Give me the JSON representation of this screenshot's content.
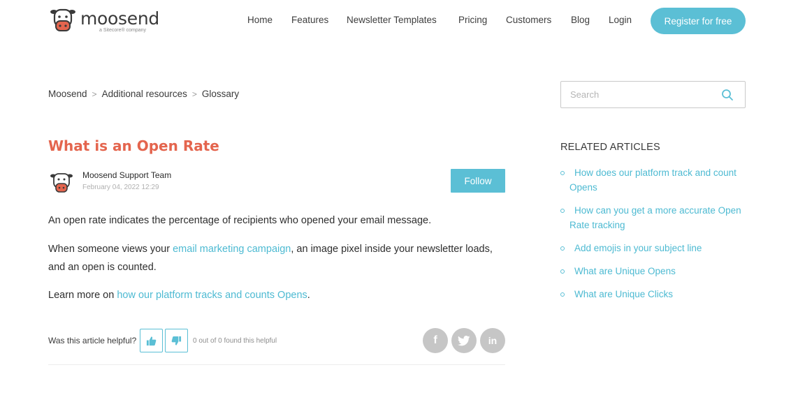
{
  "header": {
    "logo_name": "moosend",
    "logo_sub": "a Sitecore® company",
    "nav": [
      "Home",
      "Features",
      "Newsletter Templates",
      "Pricing",
      "Customers",
      "Blog",
      "Login"
    ],
    "register_label": "Register for free"
  },
  "breadcrumb": [
    "Moosend",
    "Additional resources",
    "Glossary"
  ],
  "search": {
    "placeholder": "Search"
  },
  "article": {
    "title": "What is an Open Rate",
    "author": "Moosend Support Team",
    "date": "February 04, 2022 12:29",
    "follow_label": "Follow",
    "p1": "An open rate indicates the percentage of recipients who opened your email message.",
    "p2_before": "When someone views your ",
    "p2_link": "email marketing campaign",
    "p2_after": ", an image pixel inside your newsletter loads, and an open is counted.",
    "p3_before": "Learn more on ",
    "p3_link": "how our platform tracks and counts Opens",
    "p3_after": "."
  },
  "feedback": {
    "question": "Was this article helpful?",
    "count_text": "0 out of 0 found this helpful"
  },
  "share": {
    "facebook": "f",
    "linkedin": "in"
  },
  "related": {
    "title": "RELATED ARTICLES",
    "items": [
      "How does our platform track and count Opens",
      "How can you get a more accurate Open Rate tracking",
      "Add emojis in your subject line",
      "What are Unique Opens",
      "What are Unique Clicks"
    ]
  },
  "colors": {
    "accent": "#5bbfd5",
    "link": "#4dbad2",
    "title": "#e4654e",
    "share_bg": "#c6c6c6"
  }
}
